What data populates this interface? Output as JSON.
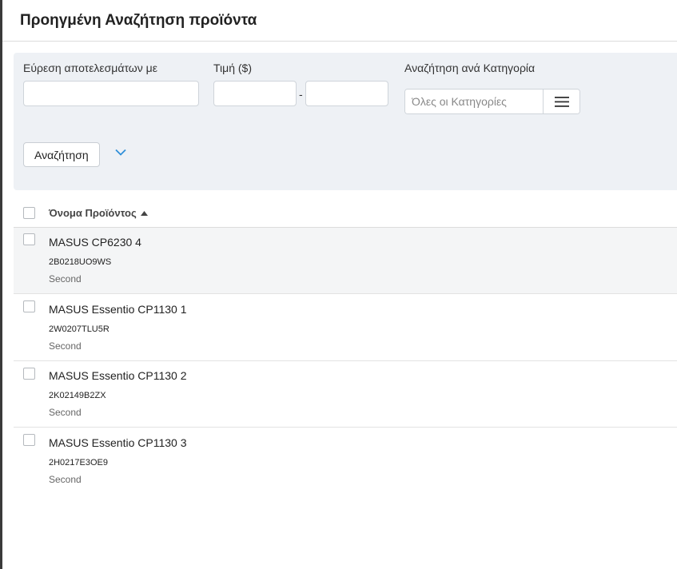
{
  "dialog": {
    "title": "Προηγμένη Αναζήτηση προϊόντα"
  },
  "filters": {
    "keyword": {
      "label": "Εύρεση αποτελεσμάτων με",
      "value": ""
    },
    "price": {
      "label": "Τιμή ($)",
      "min_value": "",
      "max_value": "",
      "separator": "-"
    },
    "category": {
      "label": "Αναζήτηση ανά Κατηγορία",
      "placeholder": "Όλες οι Κατηγορίες",
      "menu_icon": "hamburger-icon"
    },
    "search_button": "Αναζήτηση",
    "expand_icon": "chevron-down-icon",
    "accent_color": "#2f8fd8"
  },
  "table": {
    "column_header": "Όνομα Προϊόντος",
    "sort_icon": "sort-ascending-icon",
    "rows": [
      {
        "name": "MASUS CP6230 4",
        "sku": "2B0218UO9WS",
        "condition": "Second"
      },
      {
        "name": "MASUS Essentio CP1130 1",
        "sku": "2W0207TLU5R",
        "condition": "Second"
      },
      {
        "name": "MASUS Essentio CP1130 2",
        "sku": "2K02149B2ZX",
        "condition": "Second"
      },
      {
        "name": "MASUS Essentio CP1130 3",
        "sku": "2H0217E3OE9",
        "condition": "Second"
      }
    ]
  }
}
